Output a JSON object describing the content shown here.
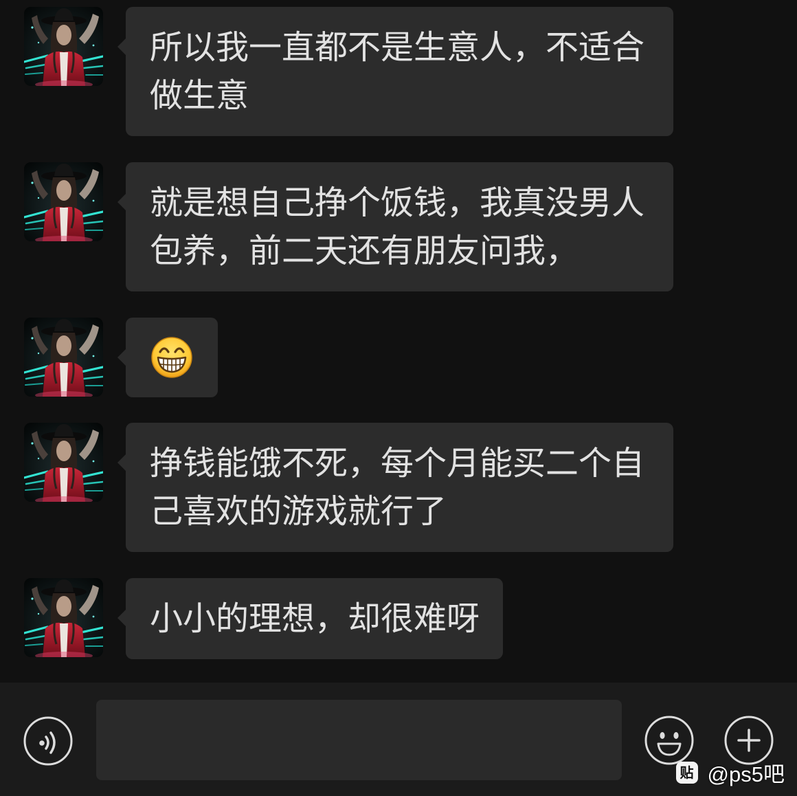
{
  "messages": [
    {
      "type": "text",
      "text": "所以我一直都不是生意人，不适合做生意"
    },
    {
      "type": "text",
      "text": "就是想自己挣个饭钱，我真没男人包养，前二天还有朋友问我，"
    },
    {
      "type": "emoji",
      "emoji": "grinning-face-with-smiling-eyes"
    },
    {
      "type": "text",
      "text": "挣钱能饿不死，每个月能买二个自己喜欢的游戏就行了"
    },
    {
      "type": "text",
      "text": "小小的理想，却很难呀"
    }
  ],
  "input_bar": {
    "voice_icon": "voice-icon",
    "message_value": "",
    "emoji_icon": "smiley-face-icon",
    "more_icon": "plus-icon"
  },
  "watermark": {
    "logo_text": "贴",
    "text": "@ps5吧"
  },
  "colors": {
    "background": "#111111",
    "bubble": "#2c2c2c",
    "text": "#e2e2e2",
    "bar": "#1b1b1b",
    "input": "#2a2a2a",
    "icon": "#dcdcdc"
  }
}
